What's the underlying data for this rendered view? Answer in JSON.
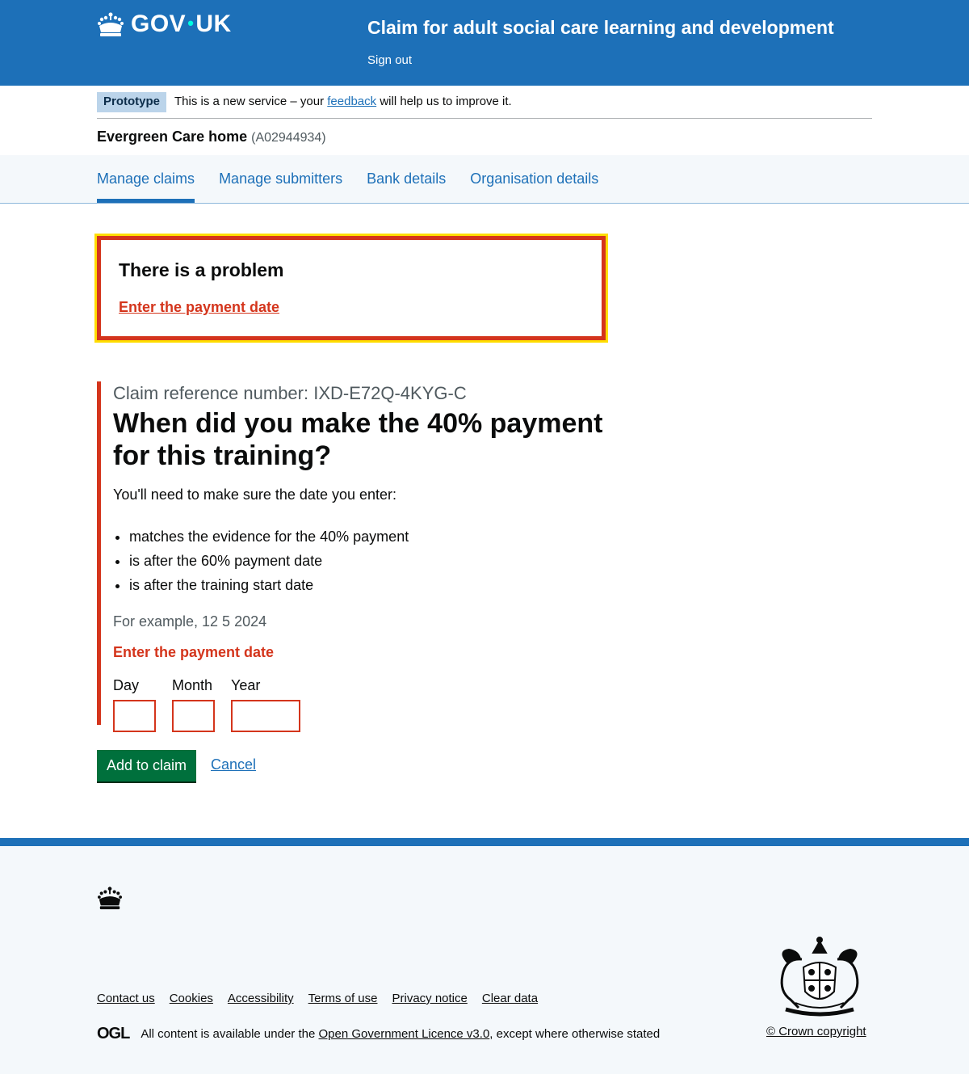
{
  "header": {
    "logo_text": "GOV",
    "logo_text_suffix": "UK",
    "service_name": "Claim for adult social care learning and development",
    "sign_out": "Sign out"
  },
  "phase_banner": {
    "tag": "Prototype",
    "text_before": "This is a new service – your",
    "link": "feedback",
    "text_after": "will help us to improve it."
  },
  "organisation": {
    "name": "Evergreen Care home",
    "id": "(A02944934)"
  },
  "nav": {
    "items": [
      {
        "label": "Manage claims",
        "active": true
      },
      {
        "label": "Manage submitters",
        "active": false
      },
      {
        "label": "Bank details",
        "active": false
      },
      {
        "label": "Organisation details",
        "active": false
      }
    ]
  },
  "error_summary": {
    "title": "There is a problem",
    "link": "Enter the payment date"
  },
  "form": {
    "caption": "Claim reference number: IXD-E72Q-4KYG-C",
    "heading": "When did you make the 40% payment for this training?",
    "intro": "You'll need to make sure the date you enter:",
    "bullets": [
      "matches the evidence for the 40% payment",
      "is after the 60% payment date",
      "is after the training start date"
    ],
    "hint": "For example, 12 5 2024",
    "error": "Enter the payment date",
    "day_label": "Day",
    "month_label": "Month",
    "year_label": "Year",
    "day_value": "",
    "month_value": "",
    "year_value": ""
  },
  "actions": {
    "submit": "Add to claim",
    "cancel": "Cancel"
  },
  "footer": {
    "links": [
      "Contact us",
      "Cookies",
      "Accessibility",
      "Terms of use",
      "Privacy notice",
      "Clear data"
    ],
    "ogl": "OGL",
    "licence_before": "All content is available under the",
    "licence_link": "Open Government Licence v3.0",
    "licence_after": ", except where otherwise stated",
    "copyright": "© Crown copyright"
  },
  "colors": {
    "brand": "#1d70b8",
    "error": "#d4351c",
    "focus": "#ffdd00",
    "button": "#00703c"
  }
}
